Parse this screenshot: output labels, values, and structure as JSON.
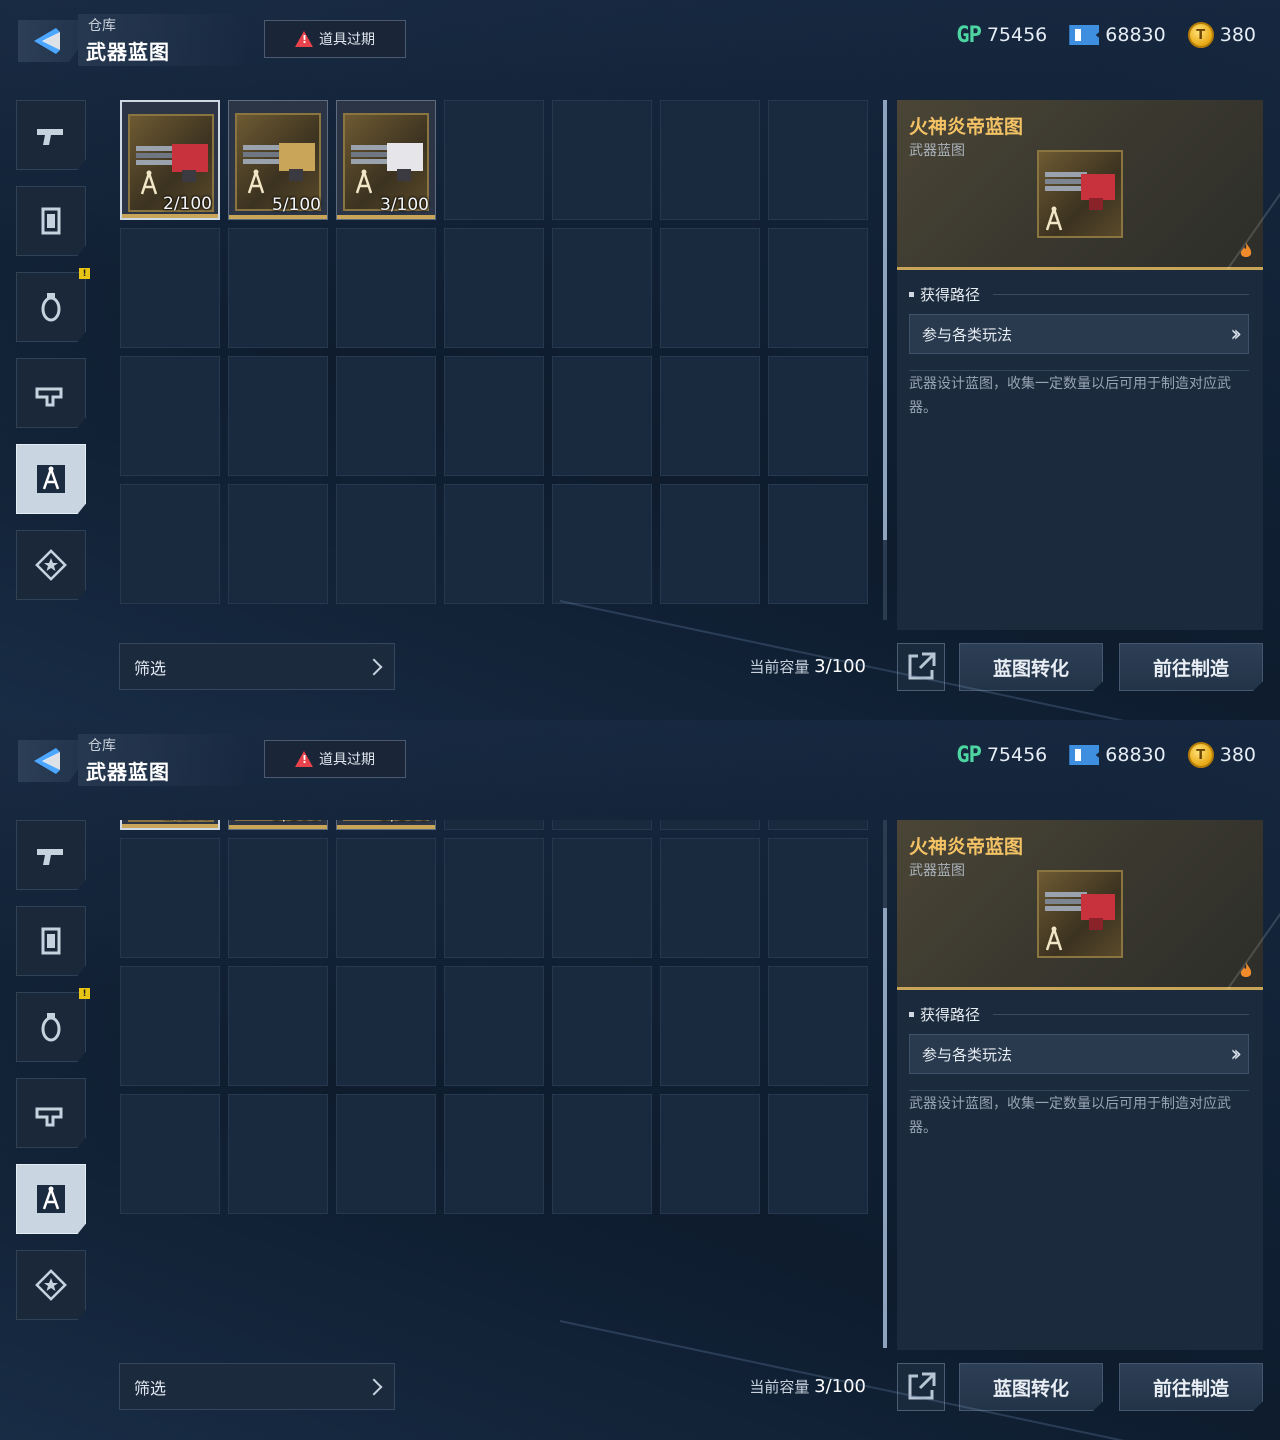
{
  "header": {
    "breadcrumb": "仓库",
    "title": "武器蓝图",
    "alert_label": "道具过期"
  },
  "currencies": [
    {
      "icon": "gp-icon",
      "label": "GP",
      "value": "75456"
    },
    {
      "icon": "ticket-icon",
      "value": "68830"
    },
    {
      "icon": "gold-coin-icon",
      "value": "380"
    }
  ],
  "sidebar": [
    {
      "name": "weapon",
      "icon": "pistol-icon",
      "active": false,
      "badge": false
    },
    {
      "name": "armor",
      "icon": "armor-icon",
      "active": false,
      "badge": false
    },
    {
      "name": "consumable",
      "icon": "grenade-icon",
      "active": false,
      "badge": true
    },
    {
      "name": "attachment",
      "icon": "gun-part-icon",
      "active": false,
      "badge": false
    },
    {
      "name": "blueprint",
      "icon": "blueprint-compass-icon",
      "active": true,
      "badge": false
    },
    {
      "name": "collection",
      "icon": "star-badge-icon",
      "active": false,
      "badge": false
    }
  ],
  "items": [
    {
      "name": "火神炎帝蓝图",
      "count": "2/100",
      "selected": true,
      "color": "#c8323c"
    },
    {
      "name": "blueprint-2",
      "count": "5/100",
      "selected": false,
      "color": "#c9a55a"
    },
    {
      "name": "blueprint-3",
      "count": "3/100",
      "selected": false,
      "color": "#e5e5ea"
    }
  ],
  "grid": {
    "columns": 7,
    "rows": 4
  },
  "filter": {
    "label": "筛选"
  },
  "capacity": {
    "label": "当前容量",
    "value": "3/100"
  },
  "detail": {
    "item_name": "火神炎帝蓝图",
    "item_type": "武器蓝图",
    "source_title": "获得路径",
    "source_route": "参与各类玩法",
    "description": "武器设计蓝图，收集一定数量以后可用于制造对应武器。"
  },
  "actions": {
    "convert": "蓝图转化",
    "craft": "前往制造"
  },
  "colors": {
    "accent_gold": "#c9a55a",
    "item_name": "#f3c265",
    "gp": "#4ed6a2",
    "alert": "#e8424a"
  }
}
